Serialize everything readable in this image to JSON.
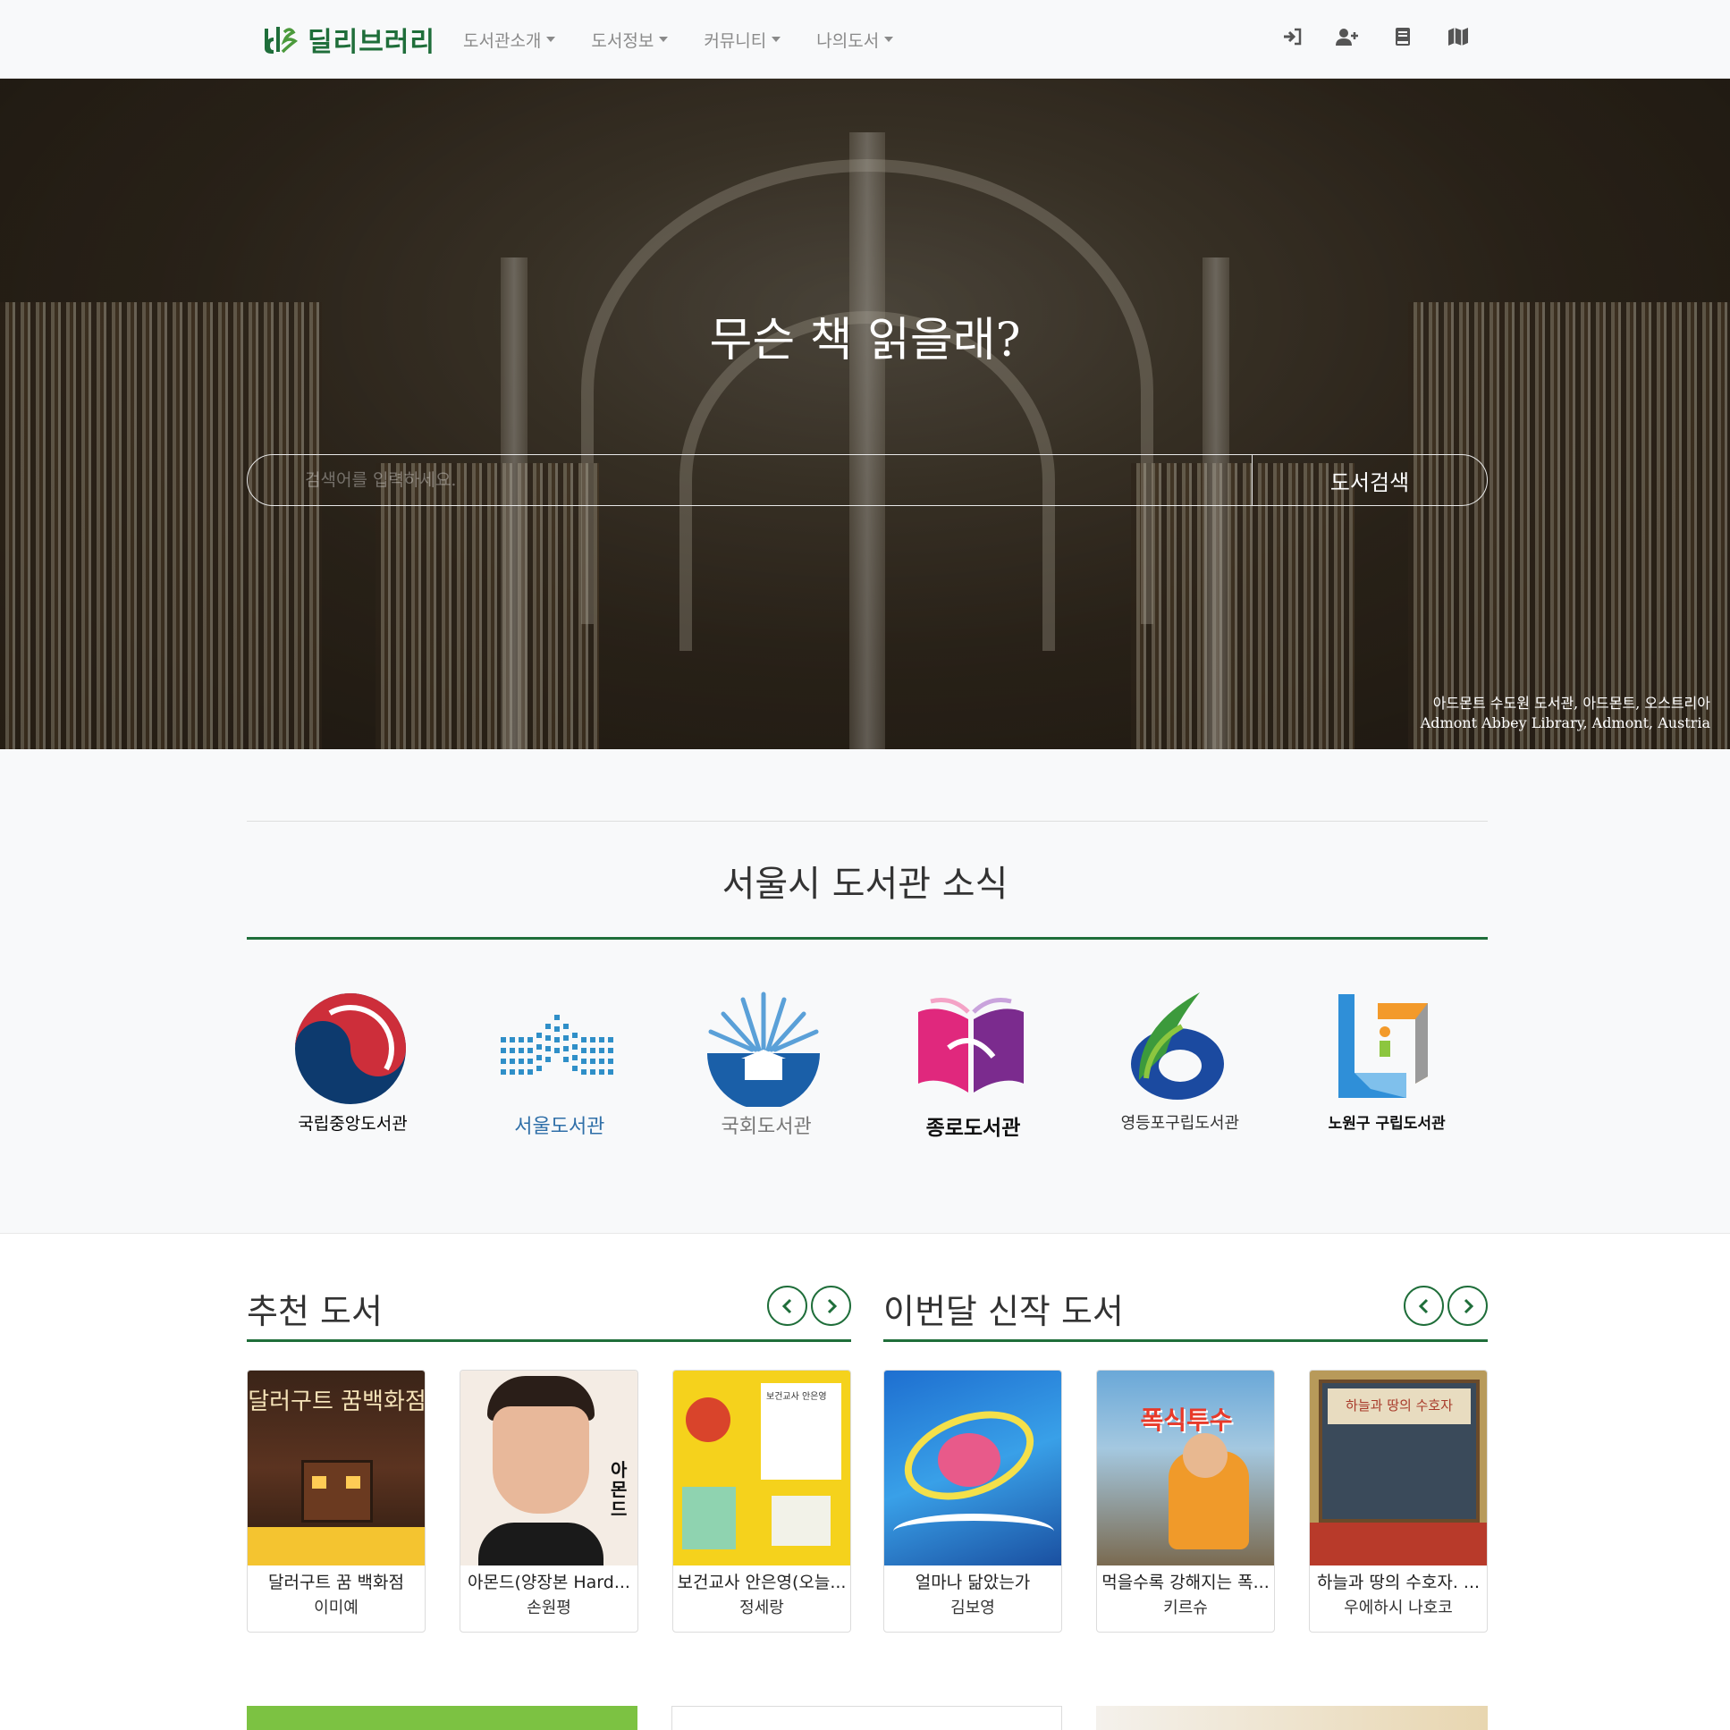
{
  "brand": {
    "name": "딜리브러리",
    "color": "#1f6e3a"
  },
  "nav": {
    "items": [
      {
        "label": "도서관소개"
      },
      {
        "label": "도서정보"
      },
      {
        "label": "커뮤니티"
      },
      {
        "label": "나의도서"
      }
    ],
    "icons": [
      "sign-in-icon",
      "user-plus-icon",
      "book-icon",
      "map-icon"
    ]
  },
  "hero": {
    "title": "무슨 책 읽을래?",
    "search": {
      "placeholder": "검색어를 입력하세요.",
      "value": "",
      "button": "도서검색"
    },
    "caption_ko": "아드몬트 수도원 도서관, 아드몬트, 오스트리아",
    "caption_en": "Admont Abbey Library, Admont, Austria"
  },
  "news": {
    "title": "서울시 도서관 소식",
    "libraries": [
      {
        "name": "국립중앙도서관",
        "color": "#444444"
      },
      {
        "name": "서울도서관",
        "color": "#2f6fa8"
      },
      {
        "name": "국회도서관",
        "color": "#777777"
      },
      {
        "name": "종로도서관",
        "color": "#111111"
      },
      {
        "name": "영등포구립도서관",
        "color": "#333333"
      },
      {
        "name": "노원구 구립도서관",
        "color": "#111111"
      }
    ]
  },
  "recommended": {
    "title": "추천 도서",
    "books": [
      {
        "title": "달러구트 꿈 백화점",
        "author": "이미예"
      },
      {
        "title": "아몬드(양장본 Hard...",
        "author": "손원평"
      },
      {
        "title": "보건교사 안은영(오늘...",
        "author": "정세랑"
      }
    ]
  },
  "new_books": {
    "title": "이번달 신작 도서",
    "books": [
      {
        "title": "얼마나 닮았는가",
        "author": "김보영"
      },
      {
        "title": "먹을수록 강해지는 폭...",
        "author": "키르슈"
      },
      {
        "title": "하늘과 땅의 수호자. ...",
        "author": "우에하시 나호코"
      }
    ]
  },
  "covers": {
    "book1_text": "달러구트 꿈백화점",
    "book2_text": "아몬드",
    "book3_text": "보건교사 안은영",
    "book5_text": "폭식투수",
    "book6_text": "하늘과 땅의 수호자"
  }
}
